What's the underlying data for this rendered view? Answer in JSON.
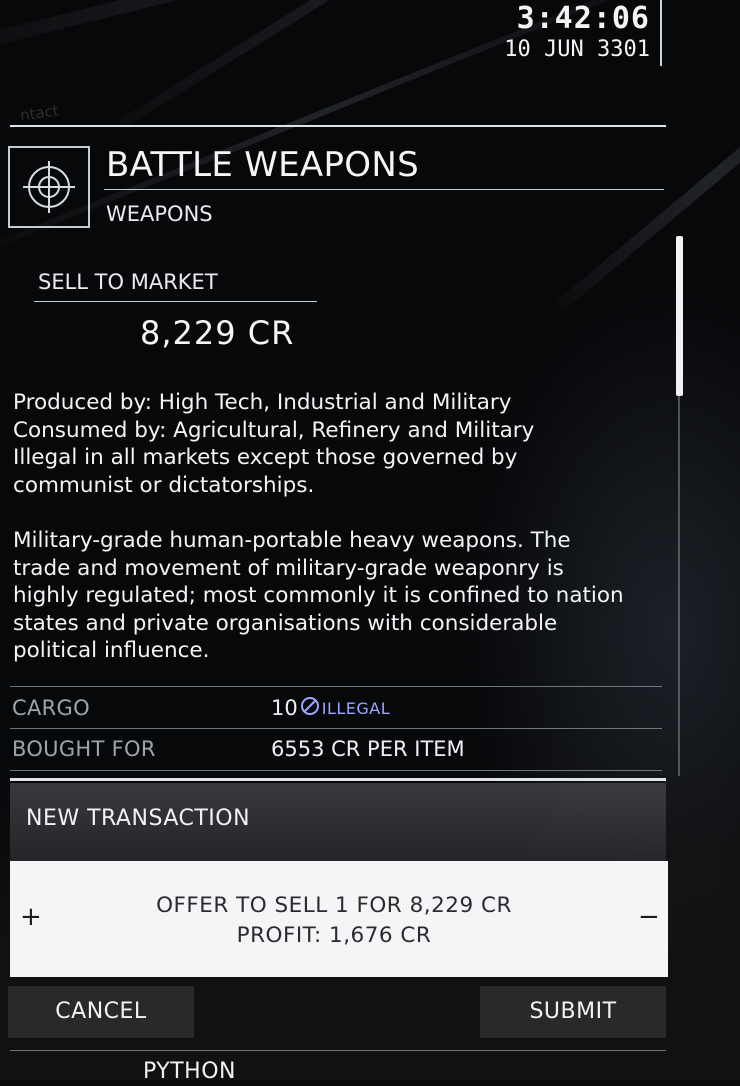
{
  "clock": {
    "time": "3:42:06",
    "date": "10 JUN 3301"
  },
  "background_label": "ntact",
  "commodity": {
    "icon": "crosshair-icon",
    "name": "BATTLE WEAPONS",
    "category": "WEAPONS"
  },
  "sell": {
    "label": "SELL TO MARKET",
    "value": "8,229 CR"
  },
  "description": {
    "origin": "Produced by: High Tech, Industrial and Military\nConsumed by: Agricultural, Refinery and Military\nIllegal in all markets except those governed by\ncommunist or dictatorships.",
    "lore": "Military-grade human-portable heavy weapons. The\ntrade and movement of military-grade weaponry is\nhighly regulated; most commonly it is confined to nation\nstates and private organisations with considerable\npolitical influence."
  },
  "details": {
    "cargo_label": "CARGO",
    "cargo_value": "10",
    "illegal_icon": "prohibited-icon",
    "illegal_label": "ILLEGAL",
    "bought_label": "BOUGHT FOR",
    "bought_value": "6553 CR PER ITEM"
  },
  "transaction": {
    "header": "NEW TRANSACTION",
    "increase": "+",
    "decrease": "−",
    "offer": "OFFER TO SELL  1 FOR 8,229 CR",
    "profit": "PROFIT:  1,676 CR",
    "cancel": "CANCEL",
    "submit": "SUBMIT"
  },
  "footer": {
    "ship": "PYTHON"
  },
  "colors": {
    "illegal": "#9ca8ff",
    "panel_line": "#dfe3e7",
    "offer_bg": "#f4f5f6"
  }
}
